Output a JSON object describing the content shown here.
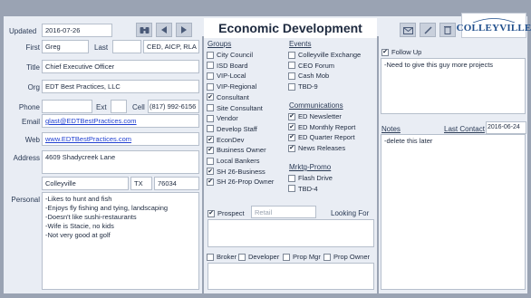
{
  "header": {
    "updated_label": "Updated",
    "updated_value": "2016-07-26",
    "title": "Economic Development"
  },
  "logo": {
    "text": "COLLEYVILLE"
  },
  "contact": {
    "first_label": "First",
    "first_value": "Greg",
    "last_label": "Last",
    "last_value": "",
    "suffix_value": "CED, AICP, RLA",
    "title_label": "Title",
    "title_value": "Chief Executive Officer",
    "org_label": "Org",
    "org_value": "EDT Best Practices, LLC",
    "phone_label": "Phone",
    "phone_value": "",
    "ext_label": "Ext",
    "ext_value": "",
    "cell_label": "Cell",
    "cell_value": "(817) 992-6156",
    "email_label": "Email",
    "email_value": "glast@EDTBestPractices.com",
    "web_label": "Web",
    "web_value": "www.EDTBestPractices.com",
    "address_label": "Address",
    "address_value": "4609 Shadycreek Lane",
    "city_value": "Colleyville",
    "state_value": "TX",
    "zip_value": "76034",
    "personal_label": "Personal",
    "personal_lines": [
      "-Likes to hunt and fish",
      "-Enjoys fly fishing and tying, landscaping",
      "-Doesn't like sushi-restaurants",
      "-Wife is Stacie, no kids",
      "-Not very good at golf"
    ]
  },
  "groups": {
    "heading": "Groups",
    "items": [
      {
        "label": "City Council",
        "checked": false
      },
      {
        "label": "ISD Board",
        "checked": false
      },
      {
        "label": "VIP-Local",
        "checked": false
      },
      {
        "label": "VIP-Regional",
        "checked": false
      },
      {
        "label": "Consultant",
        "checked": true
      },
      {
        "label": "Site Consultant",
        "checked": false
      },
      {
        "label": "Vendor",
        "checked": false
      },
      {
        "label": "Develop Staff",
        "checked": false
      },
      {
        "label": "EconDev",
        "checked": true
      },
      {
        "label": "Business Owner",
        "checked": true
      },
      {
        "label": "Local Bankers",
        "checked": false
      },
      {
        "label": "SH 26-Business",
        "checked": true
      },
      {
        "label": "SH 26-Prop Owner",
        "checked": true
      }
    ]
  },
  "events": {
    "heading": "Events",
    "items": [
      {
        "label": "Colleyville Exchange",
        "checked": false
      },
      {
        "label": "CEO Forum",
        "checked": false
      },
      {
        "label": "Cash Mob",
        "checked": false
      },
      {
        "label": "TBD-9",
        "checked": false
      }
    ]
  },
  "communications": {
    "heading": "Communications",
    "items": [
      {
        "label": "ED Newsletter",
        "checked": true
      },
      {
        "label": "ED Monthly Report",
        "checked": true
      },
      {
        "label": "ED Quarter Report",
        "checked": true
      },
      {
        "label": "News Releases",
        "checked": true
      }
    ]
  },
  "mrktg": {
    "heading": "Mrktg-Promo",
    "items": [
      {
        "label": "Flash Drive",
        "checked": false
      },
      {
        "label": "TBD-4",
        "checked": false
      }
    ]
  },
  "prospect": {
    "label": "Prospect",
    "checked": true,
    "retail_value": "Retail",
    "looking_for_label": "Looking For",
    "roles": [
      {
        "label": "Broker",
        "checked": false
      },
      {
        "label": "Developer",
        "checked": false
      },
      {
        "label": "Prop Mgr",
        "checked": false
      },
      {
        "label": "Prop Owner",
        "checked": false
      }
    ]
  },
  "followup": {
    "label": "Follow Up",
    "checked": true,
    "note": "-Need to give this guy more projects"
  },
  "notes": {
    "label": "Notes",
    "last_contact_label": "Last Contact",
    "last_contact_value": "2016-06-24",
    "text": "-delete this later"
  },
  "icons": {
    "binoculars": "binoculars-icon",
    "prev": "previous-record-icon",
    "next": "next-record-icon",
    "email": "email-icon",
    "edit": "edit-icon",
    "delete": "delete-icon"
  },
  "colors": {
    "background": "#9aa3b3",
    "panel": "#e9edf4",
    "link": "#1f3fd1",
    "text": "#2a3a55"
  }
}
